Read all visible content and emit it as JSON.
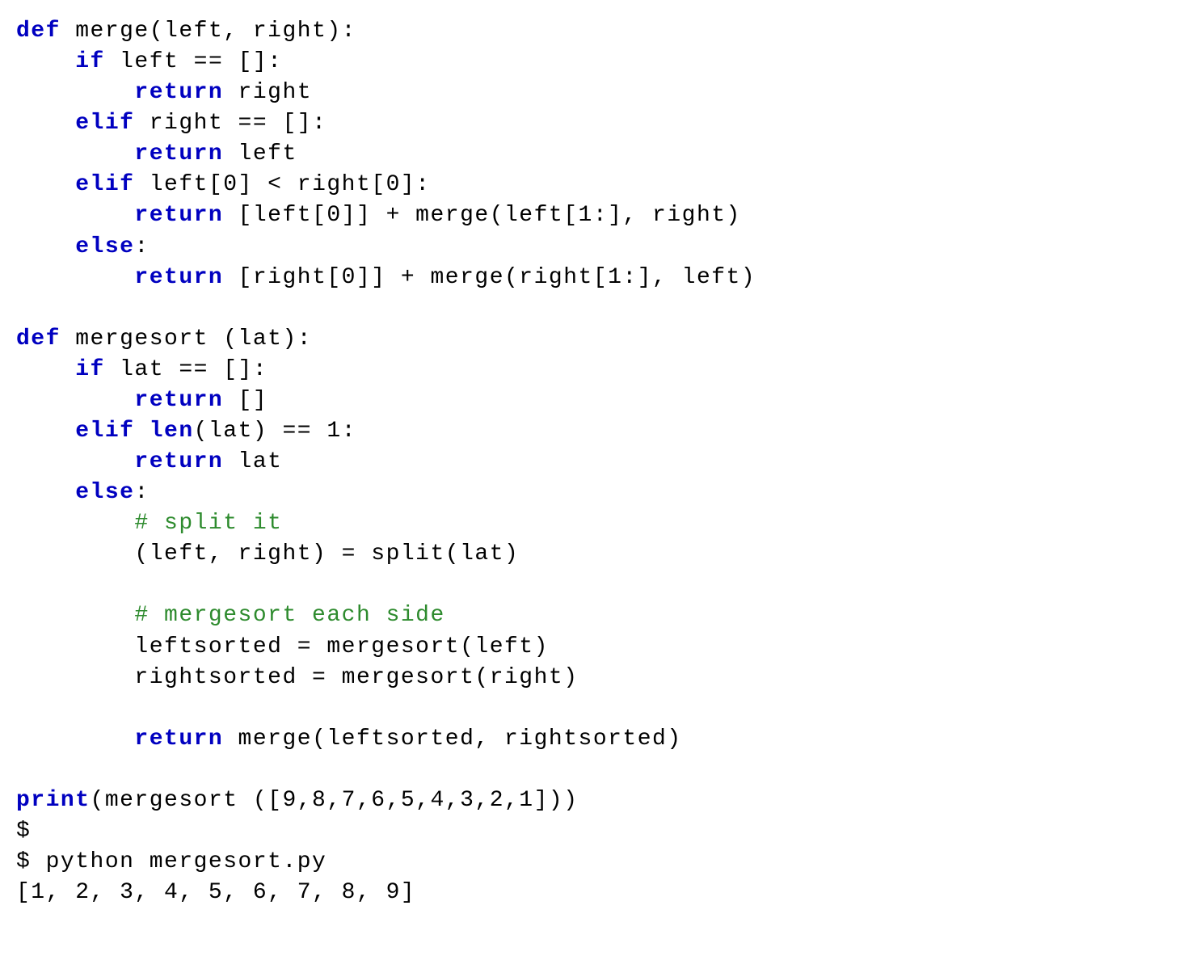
{
  "code": {
    "lines": [
      {
        "tokens": [
          {
            "cls": "kw",
            "text": "def"
          },
          {
            "cls": "txt",
            "text": " merge(left, right):"
          }
        ]
      },
      {
        "tokens": [
          {
            "cls": "txt",
            "text": "    "
          },
          {
            "cls": "kw",
            "text": "if"
          },
          {
            "cls": "txt",
            "text": " left == []:"
          }
        ]
      },
      {
        "tokens": [
          {
            "cls": "txt",
            "text": "        "
          },
          {
            "cls": "kw",
            "text": "return"
          },
          {
            "cls": "txt",
            "text": " right"
          }
        ]
      },
      {
        "tokens": [
          {
            "cls": "txt",
            "text": "    "
          },
          {
            "cls": "kw",
            "text": "elif"
          },
          {
            "cls": "txt",
            "text": " right == []:"
          }
        ]
      },
      {
        "tokens": [
          {
            "cls": "txt",
            "text": "        "
          },
          {
            "cls": "kw",
            "text": "return"
          },
          {
            "cls": "txt",
            "text": " left"
          }
        ]
      },
      {
        "tokens": [
          {
            "cls": "txt",
            "text": "    "
          },
          {
            "cls": "kw",
            "text": "elif"
          },
          {
            "cls": "txt",
            "text": " left[0] < right[0]:"
          }
        ]
      },
      {
        "tokens": [
          {
            "cls": "txt",
            "text": "        "
          },
          {
            "cls": "kw",
            "text": "return"
          },
          {
            "cls": "txt",
            "text": " [left[0]] + merge(left[1:], right)"
          }
        ]
      },
      {
        "tokens": [
          {
            "cls": "txt",
            "text": "    "
          },
          {
            "cls": "kw",
            "text": "else"
          },
          {
            "cls": "txt",
            "text": ":"
          }
        ]
      },
      {
        "tokens": [
          {
            "cls": "txt",
            "text": "        "
          },
          {
            "cls": "kw",
            "text": "return"
          },
          {
            "cls": "txt",
            "text": " [right[0]] + merge(right[1:], left)"
          }
        ]
      },
      {
        "tokens": [
          {
            "cls": "txt",
            "text": ""
          }
        ]
      },
      {
        "tokens": [
          {
            "cls": "kw",
            "text": "def"
          },
          {
            "cls": "txt",
            "text": " mergesort (lat):"
          }
        ]
      },
      {
        "tokens": [
          {
            "cls": "txt",
            "text": "    "
          },
          {
            "cls": "kw",
            "text": "if"
          },
          {
            "cls": "txt",
            "text": " lat == []:"
          }
        ]
      },
      {
        "tokens": [
          {
            "cls": "txt",
            "text": "        "
          },
          {
            "cls": "kw",
            "text": "return"
          },
          {
            "cls": "txt",
            "text": " []"
          }
        ]
      },
      {
        "tokens": [
          {
            "cls": "txt",
            "text": "    "
          },
          {
            "cls": "kw",
            "text": "elif"
          },
          {
            "cls": "txt",
            "text": " "
          },
          {
            "cls": "builtin",
            "text": "len"
          },
          {
            "cls": "txt",
            "text": "(lat) == 1:"
          }
        ]
      },
      {
        "tokens": [
          {
            "cls": "txt",
            "text": "        "
          },
          {
            "cls": "kw",
            "text": "return"
          },
          {
            "cls": "txt",
            "text": " lat"
          }
        ]
      },
      {
        "tokens": [
          {
            "cls": "txt",
            "text": "    "
          },
          {
            "cls": "kw",
            "text": "else"
          },
          {
            "cls": "txt",
            "text": ":"
          }
        ]
      },
      {
        "tokens": [
          {
            "cls": "txt",
            "text": "        "
          },
          {
            "cls": "comment",
            "text": "# split it"
          }
        ]
      },
      {
        "tokens": [
          {
            "cls": "txt",
            "text": "        (left, right) = split(lat)"
          }
        ]
      },
      {
        "tokens": [
          {
            "cls": "txt",
            "text": ""
          }
        ]
      },
      {
        "tokens": [
          {
            "cls": "txt",
            "text": "        "
          },
          {
            "cls": "comment",
            "text": "# mergesort each side"
          }
        ]
      },
      {
        "tokens": [
          {
            "cls": "txt",
            "text": "        leftsorted = mergesort(left)"
          }
        ]
      },
      {
        "tokens": [
          {
            "cls": "txt",
            "text": "        rightsorted = mergesort(right)"
          }
        ]
      },
      {
        "tokens": [
          {
            "cls": "txt",
            "text": ""
          }
        ]
      },
      {
        "tokens": [
          {
            "cls": "txt",
            "text": "        "
          },
          {
            "cls": "kw",
            "text": "return"
          },
          {
            "cls": "txt",
            "text": " merge(leftsorted, rightsorted)"
          }
        ]
      },
      {
        "tokens": [
          {
            "cls": "txt",
            "text": ""
          }
        ]
      },
      {
        "tokens": [
          {
            "cls": "builtin",
            "text": "print"
          },
          {
            "cls": "txt",
            "text": "(mergesort ([9,8,7,6,5,4,3,2,1]))"
          }
        ]
      }
    ]
  },
  "shell": {
    "line1": "$",
    "line2": "$ python mergesort.py",
    "line3": "[1, 2, 3, 4, 5, 6, 7, 8, 9]"
  }
}
